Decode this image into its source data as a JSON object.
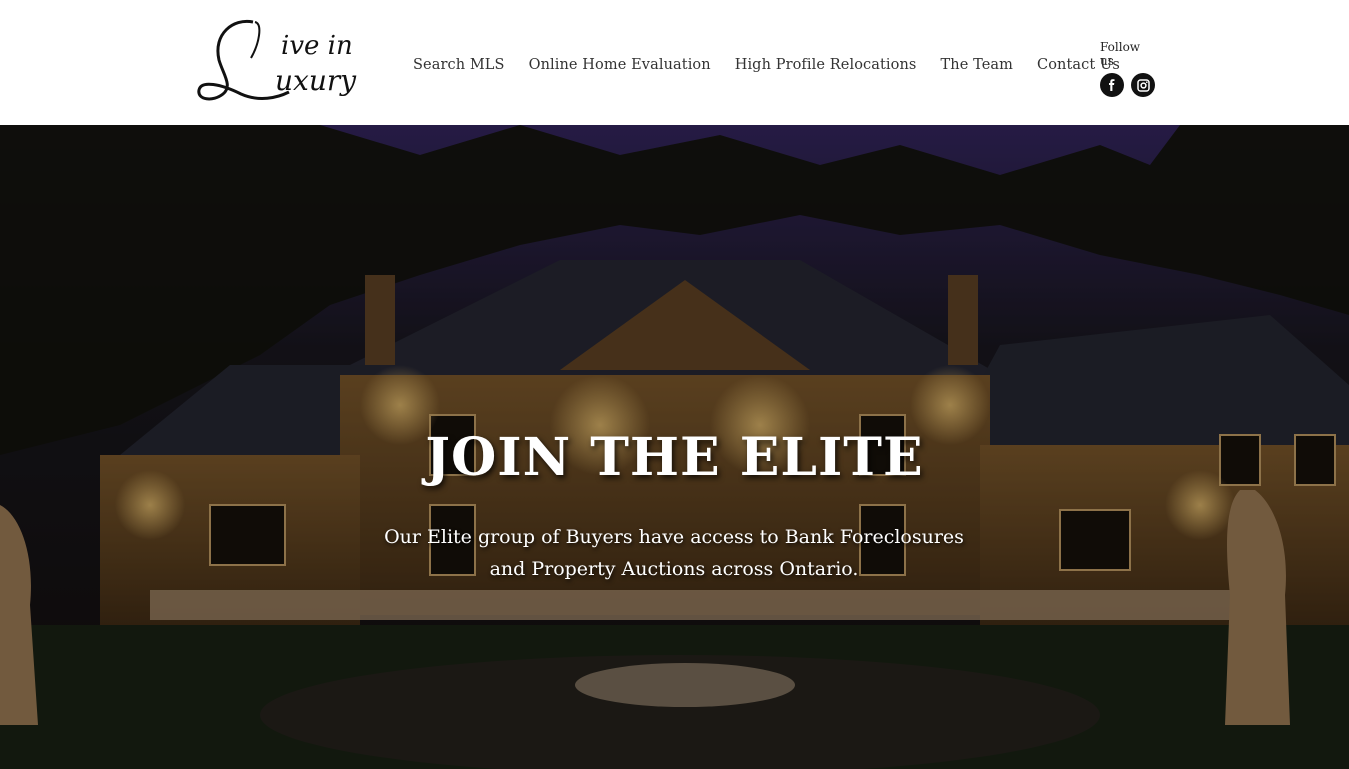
{
  "logo": {
    "alt": "Live in Luxury",
    "word1": "ive in",
    "word2": "uxury"
  },
  "nav": {
    "items": [
      {
        "label": "Search MLS"
      },
      {
        "label": "Online Home Evaluation"
      },
      {
        "label": "High Profile Relocations"
      },
      {
        "label": "The Team"
      },
      {
        "label": "Contact Us"
      }
    ]
  },
  "social": {
    "label": "Follow us",
    "icons": [
      "facebook-icon",
      "instagram-icon"
    ]
  },
  "hero": {
    "title": "JOIN THE ELITE",
    "subtitle": "Our Elite group of Buyers have access to Bank Foreclosures and Property Auctions across Ontario."
  },
  "colors": {
    "nav_text": "#333333",
    "icon_bg": "#111111",
    "hero_text": "#ffffff"
  }
}
